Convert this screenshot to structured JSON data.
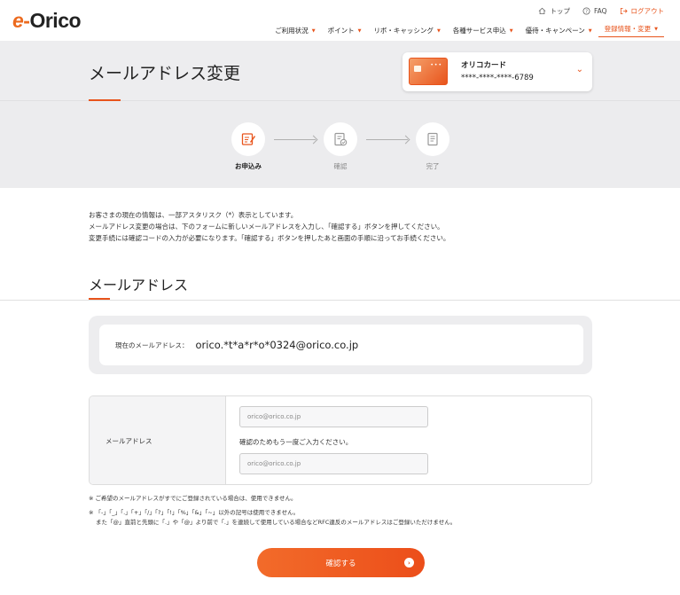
{
  "header": {
    "logo_e": "e",
    "logo_rest": "Orico",
    "util": [
      {
        "label": "トップ",
        "icon": "home-icon"
      },
      {
        "label": "FAQ",
        "icon": "question-icon"
      },
      {
        "label": "ログアウト",
        "icon": "logout-icon"
      }
    ],
    "nav": [
      {
        "label": "ご利用状況"
      },
      {
        "label": "ポイント"
      },
      {
        "label": "リボ・キャッシング"
      },
      {
        "label": "各種サービス申込"
      },
      {
        "label": "優待・キャンペーン"
      },
      {
        "label": "登録情報・変更"
      }
    ]
  },
  "page": {
    "title": "メールアドレス変更"
  },
  "card": {
    "name": "オリコカード",
    "number": "****-****-****-6789",
    "dots": "•••"
  },
  "steps": [
    {
      "label": "お申込み"
    },
    {
      "label": "確認"
    },
    {
      "label": "完了"
    }
  ],
  "intro": [
    "お客さまの現在の情報は、一部アスタリスク（*）表示としています。",
    "メールアドレス変更の場合は、下のフォームに新しいメールアドレスを入力し、「確認する」ボタンを押してください。",
    "変更手続には確認コードの入力が必要になります。「確認する」ボタンを押したあと画面の手順に沿ってお手続ください。"
  ],
  "section": {
    "title": "メールアドレス"
  },
  "current": {
    "label": "現在のメールアドレス：",
    "value": "orico.*t*a*r*o*0324@orico.co.jp"
  },
  "form": {
    "label": "メールアドレス",
    "email_placeholder": "orico@orico.co.jp",
    "confirm_text": "確認のためもう一度ご入力ください。",
    "confirm_placeholder": "orico@orico.co.jp"
  },
  "notes": [
    "※  ご希望のメールアドレスがすでにご登録されている場合は、使用できません。",
    "※  「-」「_」「.」「+」「/」「?」「!」「%」「&」「~」以外の記号は使用できません。",
    "また「@」直前と先頭に「.」や「@」より前で「.」を連続して使用している場合などRFC違反のメールアドレスはご登録いただけません。"
  ],
  "submit": {
    "label": "確認する"
  },
  "colors": {
    "accent": "#e8541c",
    "bg_gray": "#ededef"
  }
}
